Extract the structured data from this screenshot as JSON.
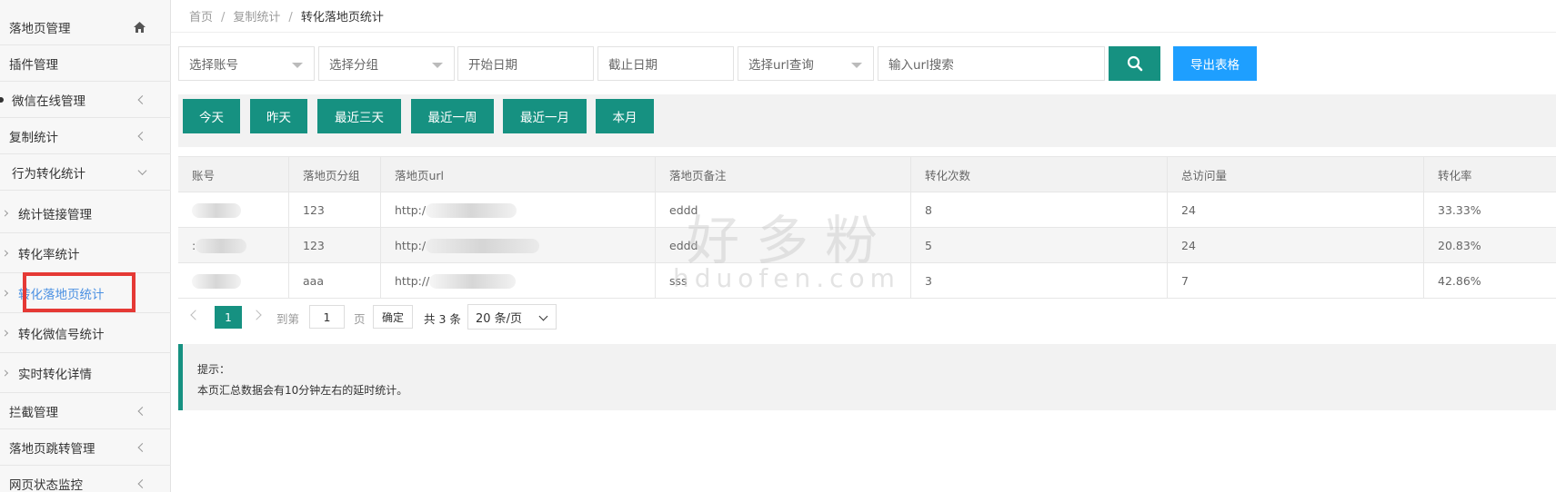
{
  "sidebar": {
    "items": [
      {
        "label": "落地页管理",
        "icon": "home-icon"
      },
      {
        "label": "插件管理"
      },
      {
        "label": "微信在线管理"
      },
      {
        "label": "复制统计"
      },
      {
        "label": "行为转化统计"
      },
      {
        "label": "统计链接管理"
      },
      {
        "label": "转化率统计"
      },
      {
        "label": "转化落地页统计"
      },
      {
        "label": "转化微信号统计"
      },
      {
        "label": "实时转化详情"
      },
      {
        "label": "拦截管理"
      },
      {
        "label": "落地页跳转管理"
      },
      {
        "label": "网页状态监控"
      }
    ],
    "active_color": "#4a90e2"
  },
  "breadcrumb": {
    "home": "首页",
    "level2": "复制统计",
    "current": "转化落地页统计"
  },
  "filters": {
    "account_select": "选择账号",
    "group_select": "选择分组",
    "start_date": "开始日期",
    "end_date": "截止日期",
    "url_select": "选择url查询",
    "url_search": "输入url搜索",
    "search_icon": "search-icon",
    "export_label": "导出表格"
  },
  "quick_dates": [
    "今天",
    "昨天",
    "最近三天",
    "最近一周",
    "最近一月",
    "本月"
  ],
  "table": {
    "headers": [
      "账号",
      "落地页分组",
      "落地页url",
      "落地页备注",
      "转化次数",
      "总访问量",
      "转化率"
    ],
    "rows": [
      {
        "account": "",
        "group": "123",
        "url": "http:/",
        "note": "eddd",
        "conversions": "8",
        "visits": "24",
        "rate": "33.33%"
      },
      {
        "account": ":",
        "group": "123",
        "url": "http:/",
        "note": "eddd",
        "conversions": "5",
        "visits": "24",
        "rate": "20.83%"
      },
      {
        "account": "",
        "group": "aaa",
        "url": "http://",
        "note": "sss",
        "conversions": "3",
        "visits": "7",
        "rate": "42.86%"
      }
    ]
  },
  "pagination": {
    "current_page": "1",
    "goto_label": "到第",
    "page_input": "1",
    "page_unit": "页",
    "confirm_label": "确定",
    "total_label": "共 3 条",
    "page_size": "20 条/页"
  },
  "notice": {
    "title": "提示：",
    "text": "本页汇总数据会有10分钟左右的延时统计。"
  },
  "watermark": {
    "cn": "好多粉",
    "en": "hduofen.com"
  },
  "colors": {
    "primary": "#169181",
    "export": "#1e9fff",
    "highlight": "#e53935"
  }
}
